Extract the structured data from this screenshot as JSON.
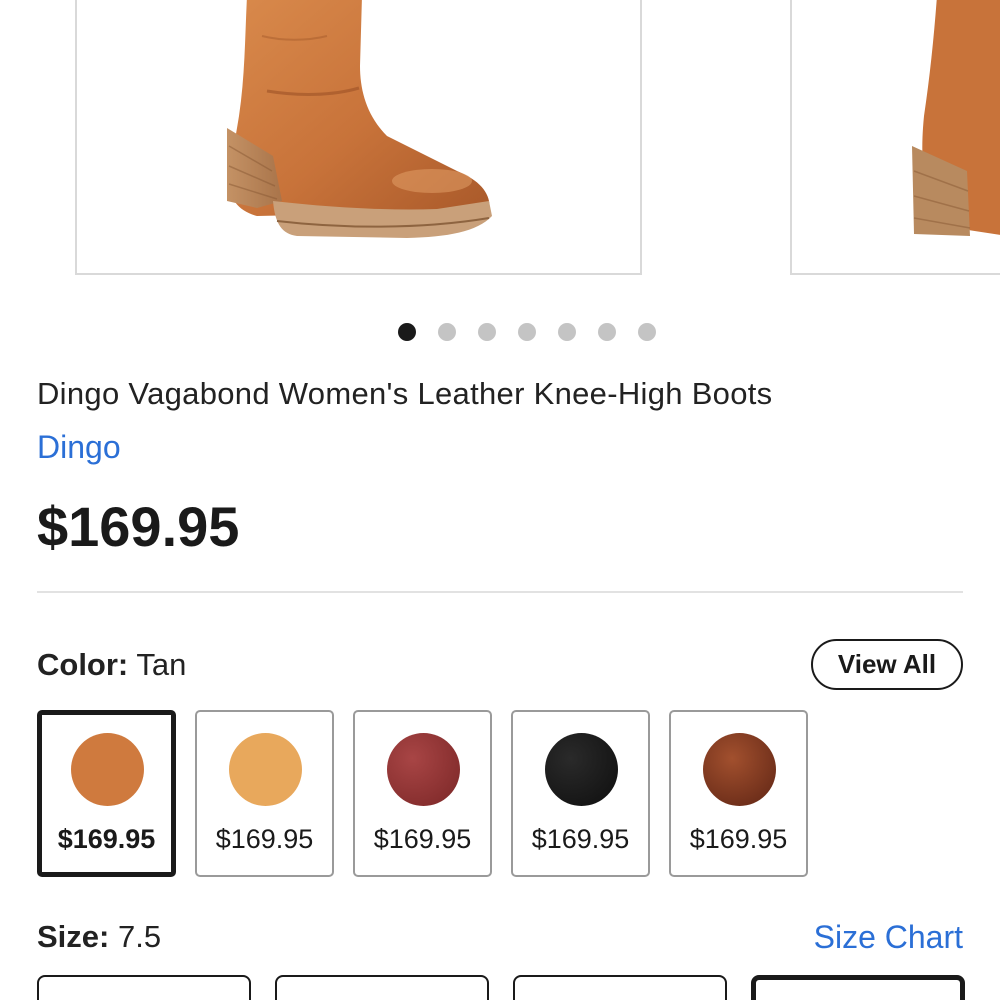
{
  "carousel": {
    "slide_count": 7,
    "active_index": 0,
    "images": [
      "boot-tan-side-view",
      "boot-tan-partial-view"
    ]
  },
  "product": {
    "title": "Dingo Vagabond Women's Leather Knee-High Boots",
    "brand": "Dingo",
    "price": "$169.95"
  },
  "color": {
    "label": "Color:",
    "selected_value": "Tan",
    "view_all_label": "View All",
    "options": [
      {
        "price": "$169.95",
        "swatch_color": "#cf7a3e",
        "selected": true
      },
      {
        "price": "$169.95",
        "swatch_color": "#e8a85c",
        "selected": false
      },
      {
        "price": "$169.95",
        "swatch_color": "#8a2f2f",
        "selected": false
      },
      {
        "price": "$169.95",
        "swatch_color": "#161616",
        "selected": false
      },
      {
        "price": "$169.95",
        "swatch_color": "#7a3522",
        "selected": false
      }
    ]
  },
  "size": {
    "label": "Size:",
    "selected_value": "7.5",
    "size_chart_label": "Size Chart"
  },
  "colors": {
    "link": "#2b6fd6",
    "text": "#1a1a1a",
    "divider": "#e2e2e2"
  }
}
